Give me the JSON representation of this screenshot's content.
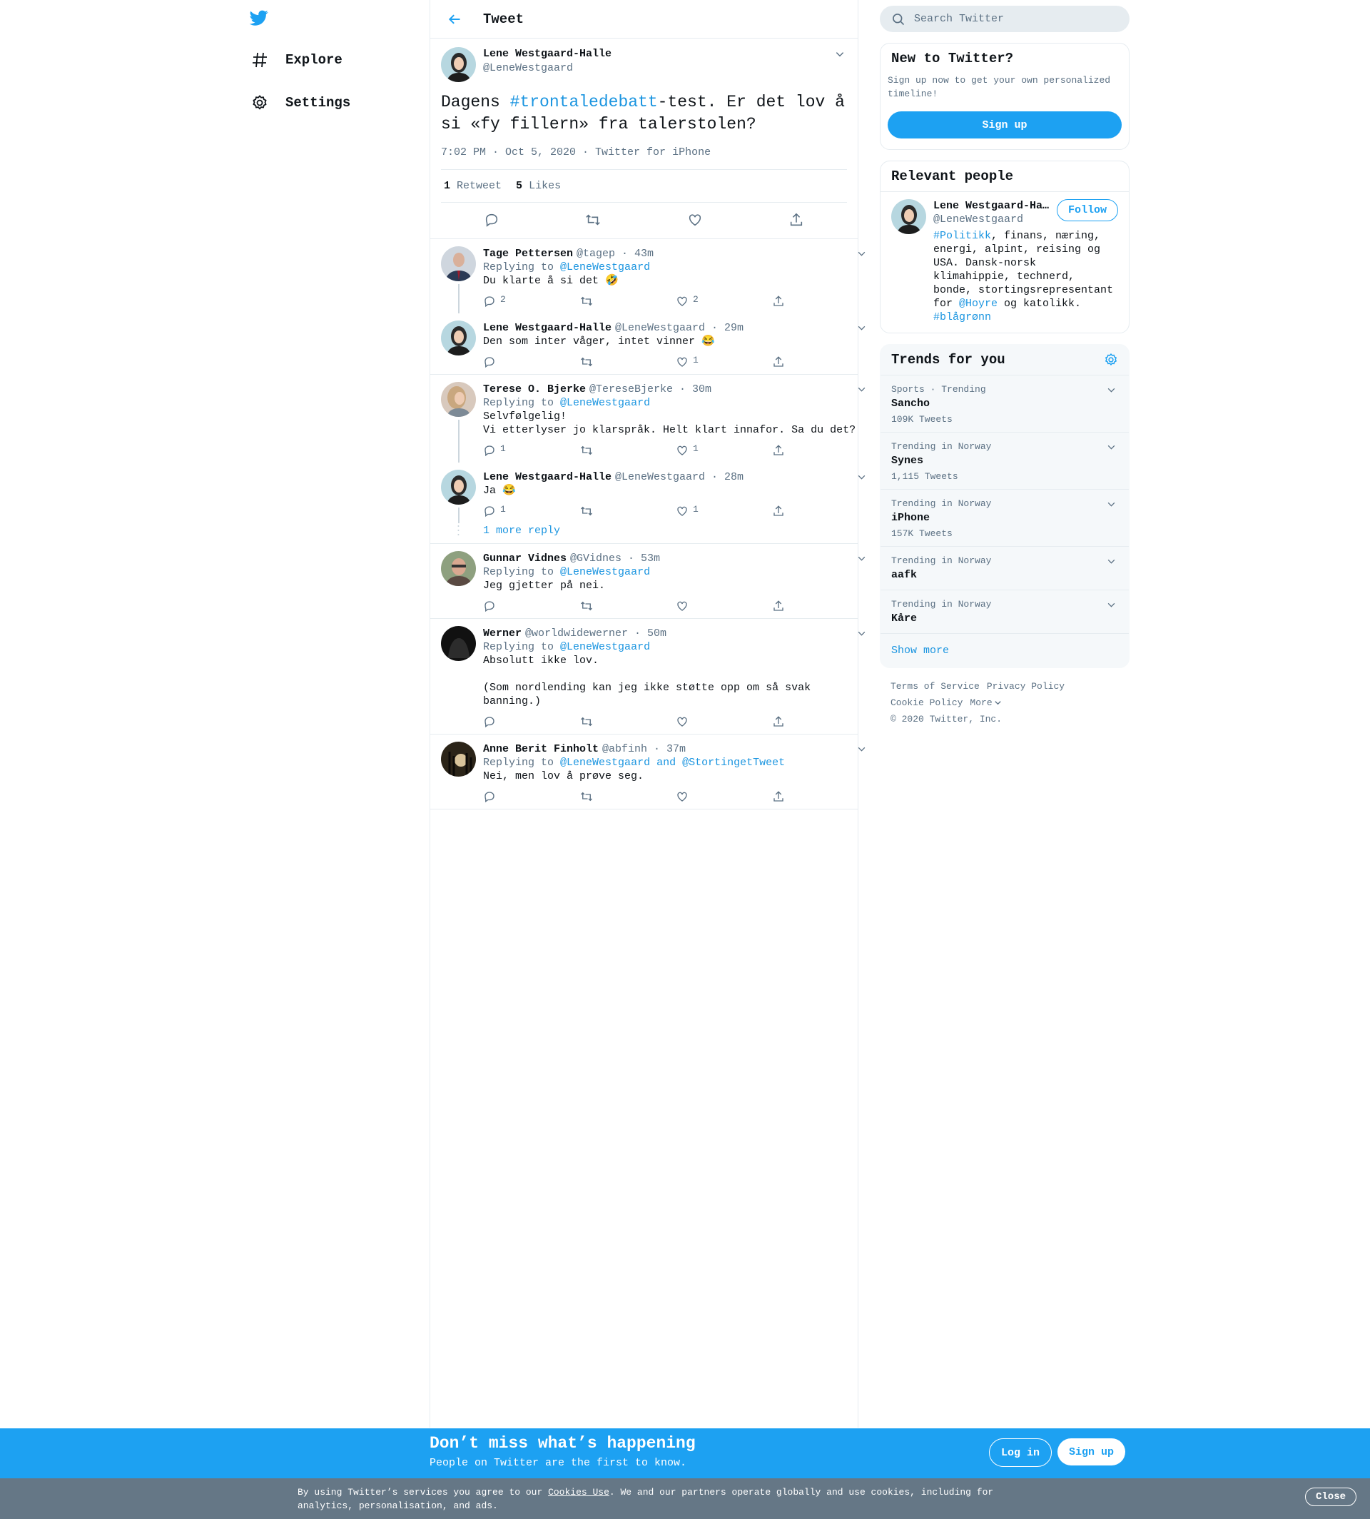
{
  "nav": {
    "explore": "Explore",
    "settings": "Settings"
  },
  "header": {
    "title": "Tweet"
  },
  "main_tweet": {
    "name": "Lene Westgaard-Halle",
    "handle": "@LeneWestgaard",
    "text_pre": "Dagens ",
    "hashtag": "#trontaledebatt",
    "text_post": "-test. Er det lov å si «fy fillern» fra talerstolen?",
    "time": "7:02 PM · Oct 5, 2020",
    "source": "Twitter for iPhone",
    "retweets": "1",
    "retweets_label": "Retweet",
    "likes": "5",
    "likes_label": "Likes"
  },
  "replies": [
    {
      "name": "Tage Pettersen",
      "meta": "@tagep · 43m",
      "replying_label": "Replying to",
      "replying_to": "@LeneWestgaard",
      "text": "Du klarte å si det 🤣",
      "reply_count": "2",
      "retweet_count": "",
      "like_count": "2"
    },
    {
      "name": "Lene Westgaard-Halle",
      "meta": "@LeneWestgaard · 29m",
      "text": "Den som inter våger, intet vinner 😂",
      "reply_count": "",
      "retweet_count": "",
      "like_count": "1"
    },
    {
      "name": "Terese O. Bjerke",
      "meta": "@TereseBjerke · 30m",
      "replying_label": "Replying to",
      "replying_to": "@LeneWestgaard",
      "text": "Selvfølgelig!\nVi etterlyser jo klarspråk. Helt klart innafor. Sa du det?",
      "reply_count": "1",
      "retweet_count": "",
      "like_count": "1"
    },
    {
      "name": "Lene Westgaard-Halle",
      "meta": "@LeneWestgaard · 28m",
      "text": "Ja 😂",
      "reply_count": "1",
      "retweet_count": "",
      "like_count": "1"
    },
    {
      "name": "Gunnar Vidnes",
      "meta": "@GVidnes · 53m",
      "replying_label": "Replying to",
      "replying_to": "@LeneWestgaard",
      "text": "Jeg gjetter på nei.",
      "reply_count": "",
      "retweet_count": "",
      "like_count": ""
    },
    {
      "name": "Werner",
      "meta": "@worldwidewerner · 50m",
      "replying_label": "Replying to",
      "replying_to": "@LeneWestgaard",
      "text": "Absolutt ikke lov.\n\n(Som nordlending kan jeg ikke støtte opp om så svak banning.)",
      "reply_count": "",
      "retweet_count": "",
      "like_count": ""
    },
    {
      "name": "Anne Berit Finholt",
      "meta": "@abfinh · 37m",
      "replying_label": "Replying to",
      "replying_to": "@LeneWestgaard and @StortingetTweet",
      "text": "Nei, men lov å prøve seg.",
      "reply_count": "",
      "retweet_count": "",
      "like_count": ""
    }
  ],
  "more_reply": "1 more reply",
  "search": {
    "placeholder": "Search Twitter"
  },
  "new_to_twitter": {
    "title": "New to Twitter?",
    "text": "Sign up now to get your own personalized timeline!",
    "button": "Sign up"
  },
  "relevant": {
    "title": "Relevant people",
    "name": "Lene Westgaard-Halle",
    "handle": "@LeneWestgaard",
    "follow": "Follow",
    "bio_tag1": "#Politikk",
    "bio_mid": ", finans, næring, energi, alpint, reising og USA. Dansk-norsk klimahippie, technerd, bonde, stortingsrepresentant for ",
    "bio_mention": "@Hoyre",
    "bio_end": " og katolikk. ",
    "bio_tag2": "#blågrønn"
  },
  "trends": {
    "title": "Trends for you",
    "items": [
      {
        "meta": "Sports · Trending",
        "name": "Sancho",
        "count": "109K Tweets"
      },
      {
        "meta": "Trending in Norway",
        "name": "Synes",
        "count": "1,115 Tweets"
      },
      {
        "meta": "Trending in Norway",
        "name": "iPhone",
        "count": "157K Tweets"
      },
      {
        "meta": "Trending in Norway",
        "name": "aafk",
        "count": ""
      },
      {
        "meta": "Trending in Norway",
        "name": "Kåre",
        "count": ""
      }
    ],
    "show_more": "Show more"
  },
  "footer": {
    "terms": "Terms of Service",
    "privacy": "Privacy Policy",
    "cookie": "Cookie Policy",
    "more": "More",
    "copyright": "© 2020 Twitter, Inc."
  },
  "banner": {
    "title": "Don’t miss what’s happening",
    "subtitle": "People on Twitter are the first to know.",
    "login": "Log in",
    "signup": "Sign up"
  },
  "cookie": {
    "text_pre": "By using Twitter’s services you agree to our ",
    "link": "Cookies Use",
    "text_post": ". We and our partners operate globally and use cookies, including for analytics, personalisation, and ads.",
    "close": "Close"
  },
  "colors": {
    "accent": "#1da1f2",
    "link": "#1b95e0",
    "muted": "#5b7083",
    "border": "#e6ecf0"
  }
}
